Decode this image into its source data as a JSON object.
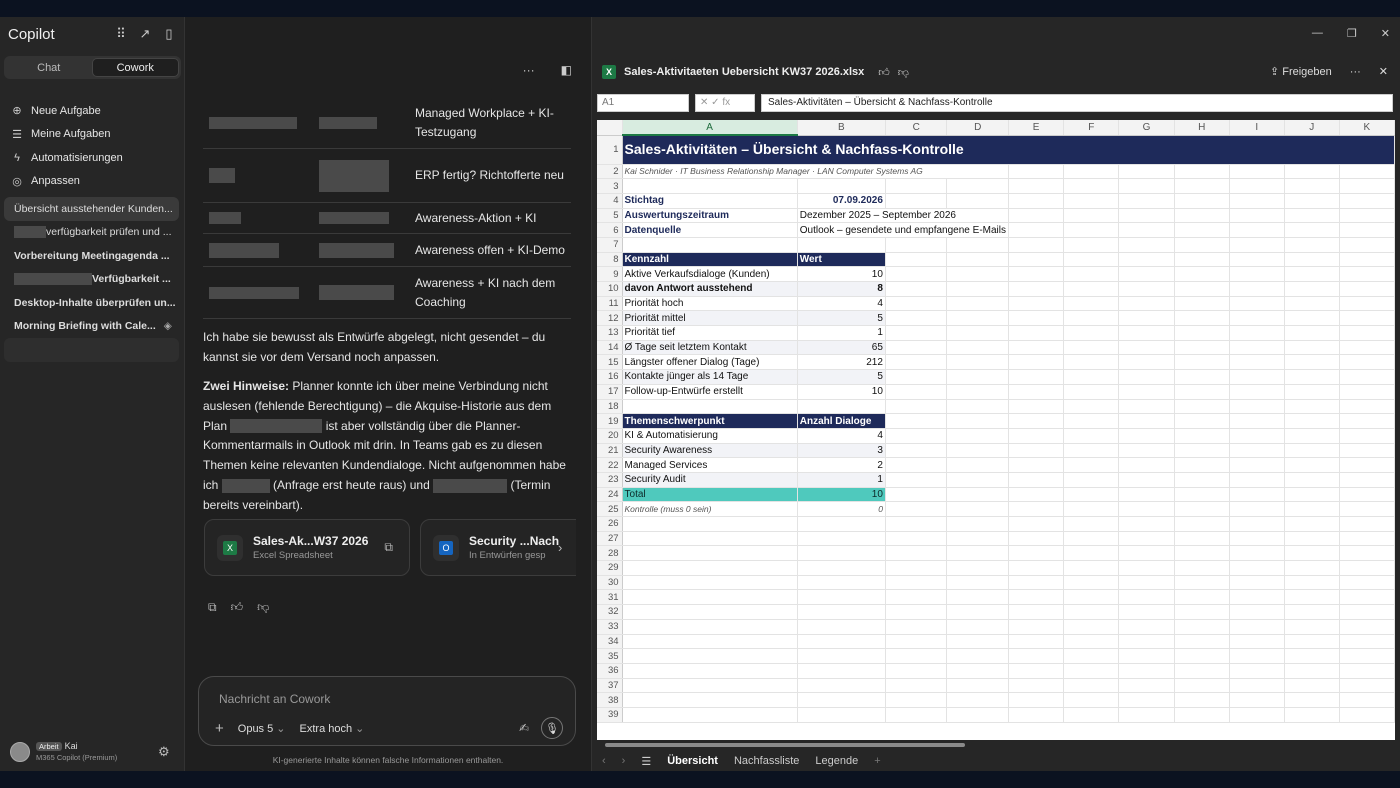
{
  "sidebar": {
    "brand": "Copilot",
    "tabs": [
      "Chat",
      "Cowork"
    ],
    "nav": [
      "Neue Aufgabe",
      "Meine Aufgaben",
      "Automatisierungen",
      "Anpassen"
    ],
    "history": [
      "Übersicht ausstehender Kunden...",
      "verfügbarkeit prüfen und ...",
      "Vorbereitung Meetingagenda ...",
      "Verfügbarkeit ...",
      "Desktop-Inhalte überprüfen un...",
      "Morning Briefing with Cale..."
    ],
    "user": {
      "tag": "Arbeit",
      "name": "Kai",
      "plan": "M365 Copilot (Premium)"
    }
  },
  "chat": {
    "rows": [
      "Managed Workplace + KI-Testzugang",
      "ERP fertig? Richtofferte neu",
      "Awareness-Aktion + KI",
      "Awareness offen + KI-Demo",
      "Awareness + KI nach dem Coaching"
    ],
    "para1": "Ich habe sie bewusst als Entwürfe abgelegt, nicht gesendet – du kannst sie vor dem Versand noch anpassen.",
    "para2_bold": "Zwei Hinweise:",
    "para2_a": " Planner konnte ich über meine Verbindung nicht auslesen (fehlende Berechtigung) – die Akquise-Historie aus dem Plan ",
    "para2_b": " ist aber vollständig über die Planner-Kommentarmails in Outlook mit drin. In Teams gab es zu diesen Themen keine relevanten Kundendialoge. Nicht aufgenommen habe ich ",
    "para2_c": " (Anfrage erst heute raus) und ",
    "para2_d": " (Termin bereits vereinbart).",
    "cards": [
      {
        "title": "Sales-Ak...W37 2026",
        "sub": "Excel Spreadsheet"
      },
      {
        "title": "Security ...Nach",
        "sub": "In Entwürfen gesp"
      }
    ],
    "placeholder": "Nachricht an Cowork",
    "model": "Opus 5",
    "effort": "Extra hoch",
    "disclaimer": "KI-generierte Inhalte können falsche Informationen enthalten."
  },
  "excel": {
    "filename": "Sales-Aktivitaeten Uebersicht KW37 2026.xlsx",
    "share": "Freigeben",
    "namebox": "A1",
    "formula": "Sales-Aktivitäten – Übersicht & Nachfass-Kontrolle",
    "columns": [
      "A",
      "B",
      "C",
      "D",
      "E",
      "F",
      "G",
      "H",
      "I",
      "J",
      "K"
    ],
    "title": "Sales-Aktivitäten – Übersicht & Nachfass-Kontrolle",
    "subtitle": "Kai Schnider · IT Business Relationship Manager · LAN Computer Systems AG",
    "meta": [
      {
        "k": "Stichtag",
        "v": "07.09.2026"
      },
      {
        "k": "Auswertungszeitraum",
        "v": "Dezember 2025 – September 2026"
      },
      {
        "k": "Datenquelle",
        "v": "Outlook – gesendete und empfangene E-Mails"
      }
    ],
    "kpi_head": [
      "Kennzahl",
      "Wert"
    ],
    "kpis": [
      {
        "k": "Aktive Verkaufsdialoge (Kunden)",
        "v": "10"
      },
      {
        "k": "davon Antwort ausstehend",
        "v": "8"
      },
      {
        "k": "Priorität hoch",
        "v": "4"
      },
      {
        "k": "Priorität mittel",
        "v": "5"
      },
      {
        "k": "Priorität tief",
        "v": "1"
      },
      {
        "k": "Ø Tage seit letztem Kontakt",
        "v": "65"
      },
      {
        "k": "Längster offener Dialog (Tage)",
        "v": "212"
      },
      {
        "k": "Kontakte jünger als 14 Tage",
        "v": "5"
      },
      {
        "k": "Follow-up-Entwürfe erstellt",
        "v": "10"
      }
    ],
    "topic_head": [
      "Themenschwerpunkt",
      "Anzahl Dialoge"
    ],
    "topics": [
      {
        "k": "KI & Automatisierung",
        "v": "4"
      },
      {
        "k": "Security Awareness",
        "v": "3"
      },
      {
        "k": "Managed Services",
        "v": "2"
      },
      {
        "k": "Security Audit",
        "v": "1"
      }
    ],
    "total": {
      "k": "Total",
      "v": "10"
    },
    "control": {
      "k": "Kontrolle (muss 0 sein)",
      "v": "0"
    },
    "sheets": [
      "Übersicht",
      "Nachfassliste",
      "Legende"
    ]
  }
}
